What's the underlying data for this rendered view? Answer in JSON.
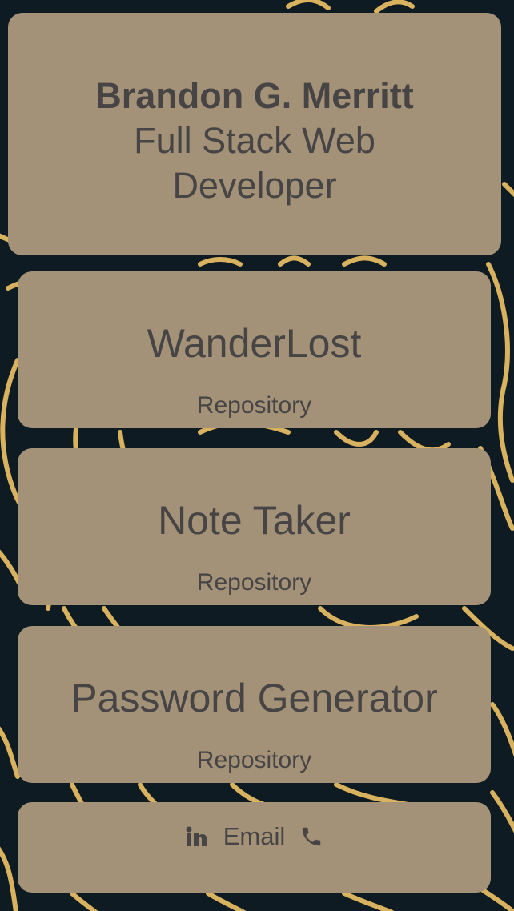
{
  "header": {
    "name": "Brandon G. Merritt",
    "title": "Full Stack Web Developer"
  },
  "projects": [
    {
      "title": "WanderLost",
      "link_label": "Repository"
    },
    {
      "title": "Note Taker",
      "link_label": "Repository"
    },
    {
      "title": "Password Generator",
      "link_label": "Repository"
    }
  ],
  "footer": {
    "linkedin_icon": "linkedin-icon",
    "email_label": "Email",
    "phone_icon": "phone-icon"
  },
  "colors": {
    "background": "#0e1b22",
    "card": "#a39278",
    "text": "#464444",
    "line_accent": "#d9b25f"
  }
}
